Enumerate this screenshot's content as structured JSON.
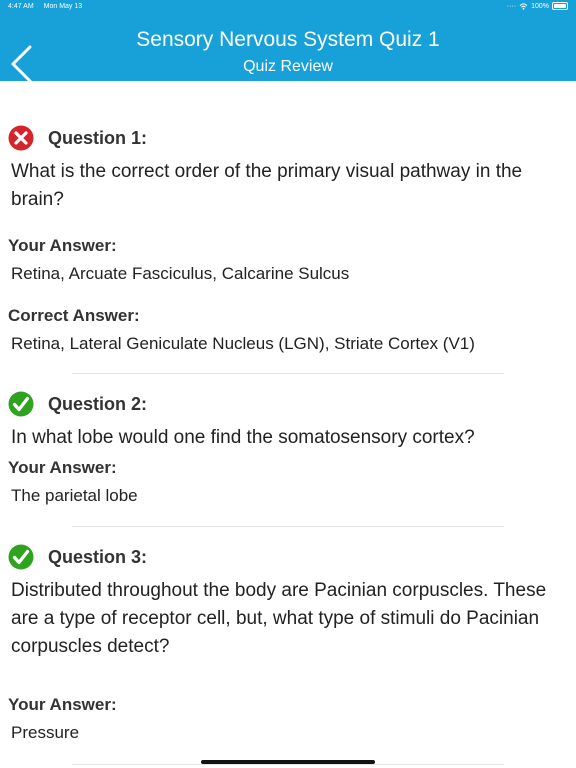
{
  "status": {
    "time": "4:47 AM",
    "date": "Mon May 13",
    "battery": "100%"
  },
  "header": {
    "title": "Sensory Nervous System Quiz 1",
    "subtitle": "Quiz Review"
  },
  "questions": [
    {
      "label": "Question 1:",
      "correct": false,
      "text": "What is the correct order of the primary visual pathway in the brain?",
      "your_answer_label": "Your Answer:",
      "your_answer": "Retina, Arcuate Fasciculus, Calcarine Sulcus",
      "correct_answer_label": "Correct Answer:",
      "correct_answer": "Retina, Lateral Geniculate Nucleus (LGN), Striate Cortex (V1)"
    },
    {
      "label": "Question 2:",
      "correct": true,
      "text": "In what lobe would one find the somatosensory cortex?",
      "your_answer_label": "Your Answer:",
      "your_answer": "The parietal lobe"
    },
    {
      "label": "Question 3:",
      "correct": true,
      "text": "Distributed throughout the body are Pacinian corpuscles. These are a type of receptor cell, but, what type of stimuli do Pacinian corpuscles detect?",
      "your_answer_label": "Your Answer:",
      "your_answer": "Pressure"
    }
  ],
  "colors": {
    "header_bg": "#17a1d8",
    "wrong": "#d6252a",
    "right": "#2fa21f"
  }
}
